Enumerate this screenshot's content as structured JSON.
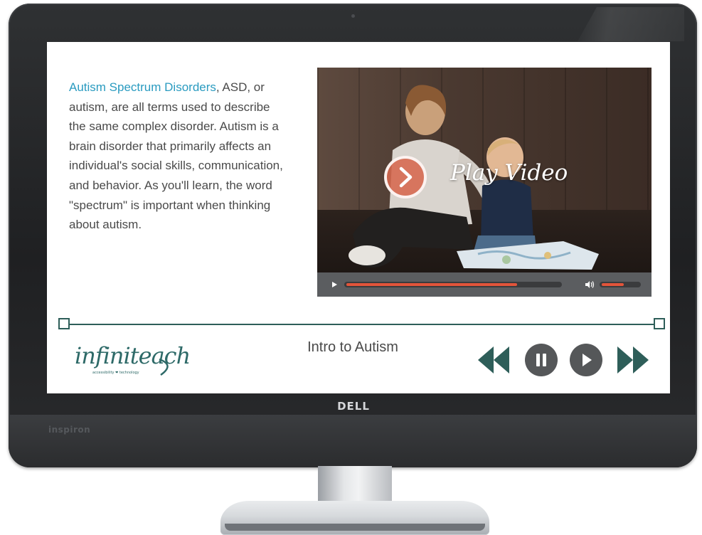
{
  "device": {
    "brand": "D¢LL",
    "model": "inspiron"
  },
  "lesson": {
    "link_text": "Autism Spectrum Disorders",
    "paragraph_rest": ", ASD, or autism, are all terms used to describe the same complex disorder. Autism is a brain disorder that primarily affects an individual's social skills, communication, and behavior. As you'll learn, the word \"spectrum\" is important when thinking about autism.",
    "title": "Intro to Autism"
  },
  "video": {
    "overlay_label": "Play Video",
    "progress": 0.8,
    "volume": 0.6
  },
  "branding": {
    "logo_text": "infiniteach",
    "tagline": "accessibility ❤ technology"
  },
  "nav": {
    "icons": [
      "rewind-icon",
      "pause-icon",
      "play-icon",
      "fast-forward-icon"
    ]
  },
  "colors": {
    "accent_teal": "#2e5e59",
    "link_blue": "#2a9bc0",
    "progress_red": "#e2543a",
    "play_orange": "#d6684e",
    "nav_button": "#555759"
  }
}
